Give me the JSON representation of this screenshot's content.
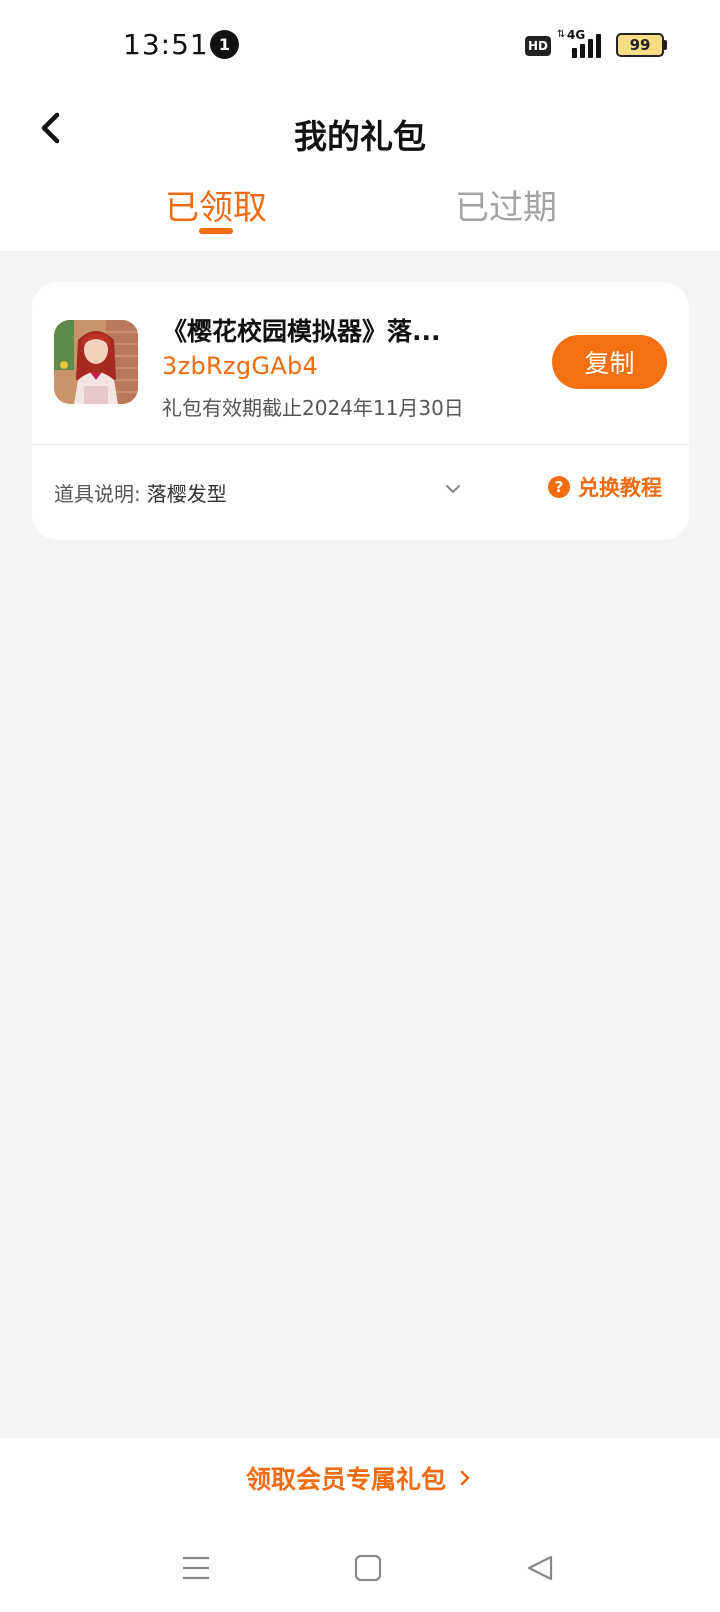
{
  "status_bar": {
    "time": "13:51",
    "notification_count": "1",
    "hd": "HD",
    "network": "4G",
    "battery": "99"
  },
  "header": {
    "title": "我的礼包",
    "tabs": [
      {
        "label": "已领取",
        "active": true
      },
      {
        "label": "已过期",
        "active": false
      }
    ]
  },
  "gift": {
    "game_title": "《樱花校园模拟器》落...",
    "code": "3zbRzgGAb4",
    "validity": "礼包有效期截止2024年11月30日",
    "copy_label": "复制",
    "desc_label": "道具说明:",
    "desc_value": "落樱发型",
    "tutorial_label": "兑换教程"
  },
  "bottom": {
    "vip_label": "领取会员专属礼包"
  },
  "colors": {
    "accent": "#f26b11",
    "background": "#f4f4f6",
    "card": "#ffffff",
    "inactive_tab": "#a3a3a3"
  },
  "icons": {
    "back": "chevron-left-icon",
    "expand": "chevron-down-icon",
    "help": "question-circle-icon",
    "vip_arrow": "chevron-right-icon",
    "nav": [
      "menu-icon",
      "home-square-icon",
      "back-triangle-icon"
    ]
  }
}
